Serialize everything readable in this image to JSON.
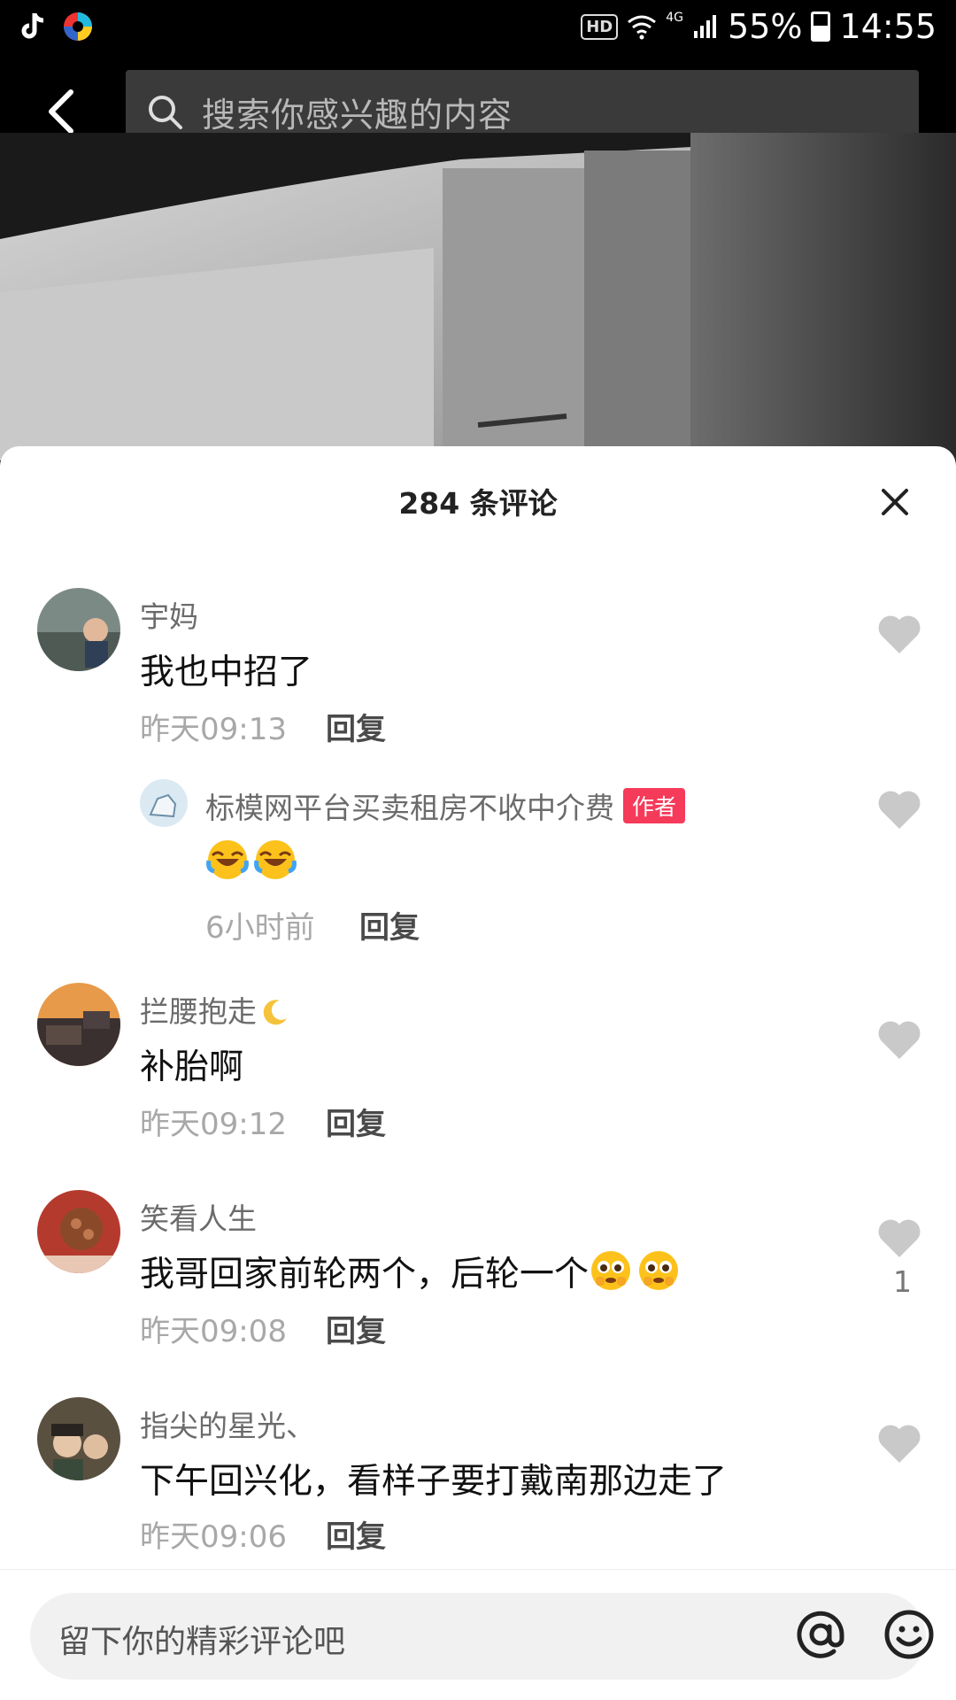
{
  "status_bar": {
    "hd": "HD",
    "network": "4G",
    "battery": "55%",
    "battery_level": 0.55,
    "time": "14:55"
  },
  "search": {
    "placeholder": "搜索你感兴趣的内容"
  },
  "comments_panel": {
    "title": "284 条评论",
    "reply_label": "回复",
    "comments": [
      {
        "user": "宇妈",
        "text": "我也中招了",
        "time": "昨天09:13"
      },
      {
        "user": "标模网平台买卖租房不收中介费",
        "badge": "作者",
        "text_emoji": [
          "face-with-tears-of-joy",
          "face-with-tears-of-joy"
        ],
        "time": "6小时前",
        "is_reply": true
      },
      {
        "user": "拦腰抱走",
        "user_emoji": "crescent-moon",
        "text": "补胎啊",
        "time": "昨天09:12"
      },
      {
        "user": "笑看人生",
        "text": "我哥回家前轮两个，后轮一个",
        "text_emoji": [
          "pleading-face",
          "pleading-face"
        ],
        "time": "昨天09:08",
        "likes": "1"
      },
      {
        "user": "指尖的星光、",
        "text": "下午回兴化，看样子要打戴南那边走了",
        "time": "昨天09:06"
      }
    ]
  },
  "input": {
    "placeholder": "留下你的精彩评论吧"
  },
  "colors": {
    "author_badge": "#f53a5a",
    "like_gray": "#c9c9c9"
  }
}
